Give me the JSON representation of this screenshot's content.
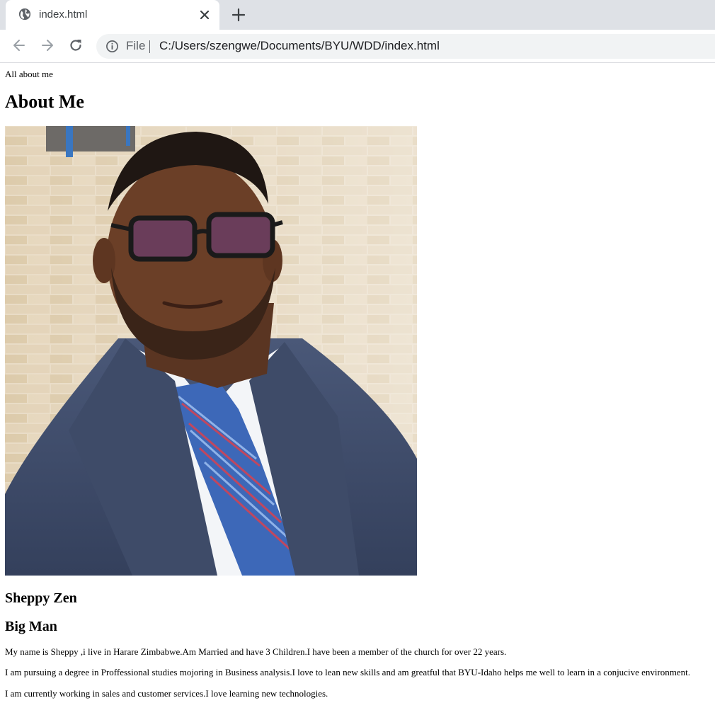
{
  "browser": {
    "tab": {
      "title": "index.html",
      "favicon": "globe-icon"
    },
    "new_tab_icon": "plus-icon",
    "nav": {
      "back": "arrow-left-icon",
      "forward": "arrow-right-icon",
      "reload": "reload-icon"
    },
    "omnibox": {
      "security_icon": "info-icon",
      "scheme_label": "File",
      "url": "C:/Users/szengwe/Documents/BYU/WDD/index.html"
    }
  },
  "page": {
    "document_title": "All about me",
    "heading": "About Me",
    "portrait_icon": "person-portrait-photo",
    "name": "Sheppy Zen",
    "subtitle": "Big Man",
    "paragraphs": [
      "My name is Sheppy ,i live in Harare Zimbabwe.Am Married and have 3 Children.I have been a member of the church for over 22 years.",
      "I am pursuing a degree in Proffessional studies mojoring in Business analysis.I love to lean new skills and am greatful that BYU-Idaho helps me well to learn in a conjucive environment.",
      "I am currently working in sales and customer services.I love learning new technologies."
    ]
  },
  "colors": {
    "tabstrip": "#dee1e6",
    "omnibox": "#f1f3f4",
    "icon": "#5f6368"
  }
}
